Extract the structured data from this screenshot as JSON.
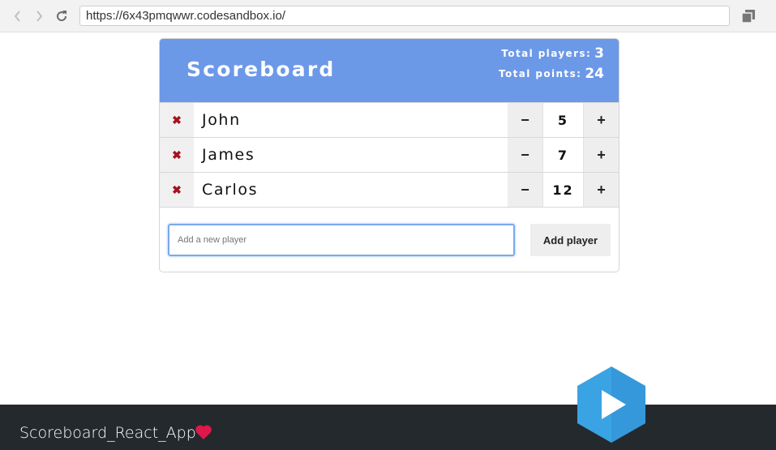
{
  "browser": {
    "url": "https://6x43pmqwwr.codesandbox.io/"
  },
  "scoreboard": {
    "title": "Scoreboard",
    "stats": {
      "total_players_label": "Total players:",
      "total_players_value": "3",
      "total_points_label": "Total points:",
      "total_points_value": "24"
    },
    "players": [
      {
        "name": "John",
        "score": "5",
        "remove": "✖",
        "decrement": "−",
        "increment": "+"
      },
      {
        "name": "James",
        "score": "7",
        "remove": "✖",
        "decrement": "−",
        "increment": "+"
      },
      {
        "name": "Carlos",
        "score": "12",
        "remove": "✖",
        "decrement": "−",
        "increment": "+"
      }
    ],
    "add_form": {
      "placeholder": "Add a new player",
      "button_label": "Add player"
    }
  },
  "footer": {
    "title": "Scoreboard_React_App",
    "heart_icon": "heart-icon",
    "play_icon": "play-icon"
  },
  "colors": {
    "header": "#6c98e8",
    "remove": "#a3131f",
    "footer": "#24292e",
    "heart": "#e0184a",
    "play_badge": "#3aa3e3"
  }
}
